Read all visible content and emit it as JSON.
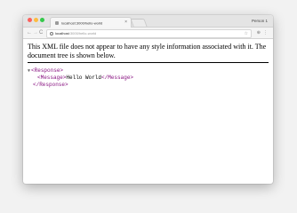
{
  "browser": {
    "tab_title": "localhost:3000/hello-world",
    "tab_close": "×",
    "profile_label": "Person 1",
    "nav": {
      "back": "←",
      "forward": "→",
      "reload": "C"
    },
    "url_host": "localhost",
    "url_path": ":3000/hello-world",
    "star": "☆",
    "menu": "⋮",
    "extension": "⊕"
  },
  "page": {
    "notice": "This XML file does not appear to have any style information associated with it. The document tree is shown below.",
    "tree": {
      "collapse_arrow": "▼",
      "root_open": "<Response>",
      "child_open": "<Message>",
      "child_text": "Hello World",
      "child_close": "</Message>",
      "root_close": "</Response>"
    }
  },
  "colors": {
    "tag": "#881280",
    "traffic_close": "#fc605c",
    "traffic_min": "#fdbc40",
    "traffic_max": "#34c84a"
  }
}
